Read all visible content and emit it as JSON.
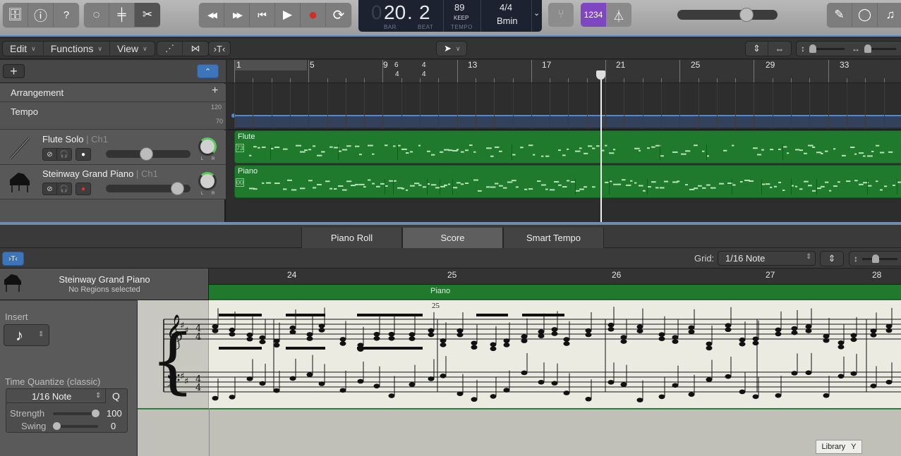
{
  "control_bar": {
    "left_group": [
      {
        "icon": "library-icon",
        "glyph": "🗄"
      },
      {
        "icon": "inspector-icon",
        "glyph": "ⓘ"
      },
      {
        "icon": "quick-help-icon",
        "glyph": "?"
      }
    ],
    "mid_group": [
      {
        "icon": "smart-controls-icon",
        "glyph": "◌"
      },
      {
        "icon": "mixer-icon",
        "glyph": "╪"
      },
      {
        "icon": "editors-scissors-icon",
        "glyph": "✂"
      }
    ],
    "transport": [
      {
        "icon": "rewind-icon",
        "glyph": "◀◀"
      },
      {
        "icon": "fast-forward-icon",
        "glyph": "▶▶"
      },
      {
        "icon": "go-to-beginning-icon",
        "glyph": "⏮"
      },
      {
        "icon": "play-icon",
        "glyph": "▶"
      },
      {
        "icon": "record-icon",
        "glyph": "●"
      },
      {
        "icon": "cycle-icon",
        "glyph": "⟳"
      }
    ],
    "lcd": {
      "bar_prefix": "0",
      "bar": "20",
      "beat": "2",
      "bar_label": "BAR",
      "beat_label": "BEAT",
      "tempo": "89",
      "tempo_mode": "KEEP",
      "tempo_label": "TEMPO",
      "time_signature": "4/4",
      "key": "Bmin"
    },
    "count_in_label": "1234",
    "master_volume": 0.7,
    "right_group": [
      {
        "icon": "note-pad-icon",
        "glyph": "✎"
      },
      {
        "icon": "loop-browser-icon",
        "glyph": "◯"
      },
      {
        "icon": "media-browser-icon",
        "glyph": "♫"
      }
    ],
    "accent_colors": {
      "record": "#d72a22",
      "count_in": "#7e46c0",
      "selection_blue": "#3d74ba",
      "region_green": "#1f7a2e"
    }
  },
  "tracks_toolbar": {
    "menus": [
      {
        "label": "Edit"
      },
      {
        "label": "Functions"
      },
      {
        "label": "View"
      }
    ],
    "pointer_tool": "pointer"
  },
  "global_tracks": {
    "arrangement_label": "Arrangement",
    "tempo_label": "Tempo",
    "tempo_max": "120",
    "tempo_min": "70"
  },
  "ruler": {
    "bars": [
      "1",
      "5",
      "9",
      "13",
      "17",
      "21",
      "25",
      "29",
      "33"
    ],
    "signature_changes": [
      {
        "bar_label": "6",
        "denom": "4"
      },
      {
        "bar_label": "4",
        "denom": "4"
      }
    ]
  },
  "tracks": [
    {
      "name": "Flute Solo",
      "channel": "| Ch1",
      "icon": "flute-icon",
      "volume": 0.5,
      "record_enabled": false,
      "region": "Flute",
      "region_value": "73"
    },
    {
      "name": "Steinway Grand Piano",
      "channel": "| Ch1",
      "icon": "grand-piano-icon",
      "volume": 0.85,
      "record_enabled": true,
      "region": "Piano",
      "region_value": "00"
    }
  ],
  "editor": {
    "tabs": [
      {
        "label": "Piano Roll",
        "selected": false
      },
      {
        "label": "Score",
        "selected": true
      },
      {
        "label": "Smart Tempo",
        "selected": false
      }
    ],
    "grid_label": "Grid:",
    "grid_value": "1/16 Note"
  },
  "inspector": {
    "track_name": "Steinway Grand Piano",
    "selection_status": "No Regions selected",
    "insert_label": "Insert",
    "insert_value": "♪",
    "quantize_label": "Time Quantize (classic)",
    "quantize_value": "1/16 Note",
    "quantize_button": "Q",
    "strength_label": "Strength",
    "strength_value": "100",
    "swing_label": "Swing",
    "swing_value": "0"
  },
  "score": {
    "bars": [
      "24",
      "25",
      "26",
      "27",
      "28"
    ],
    "region_label": "Piano",
    "measure_number": "25",
    "key_signature": "2 sharps (B minor)",
    "time_signature": "4/4"
  },
  "library_tooltip": {
    "label": "Library",
    "shortcut": "Y"
  }
}
